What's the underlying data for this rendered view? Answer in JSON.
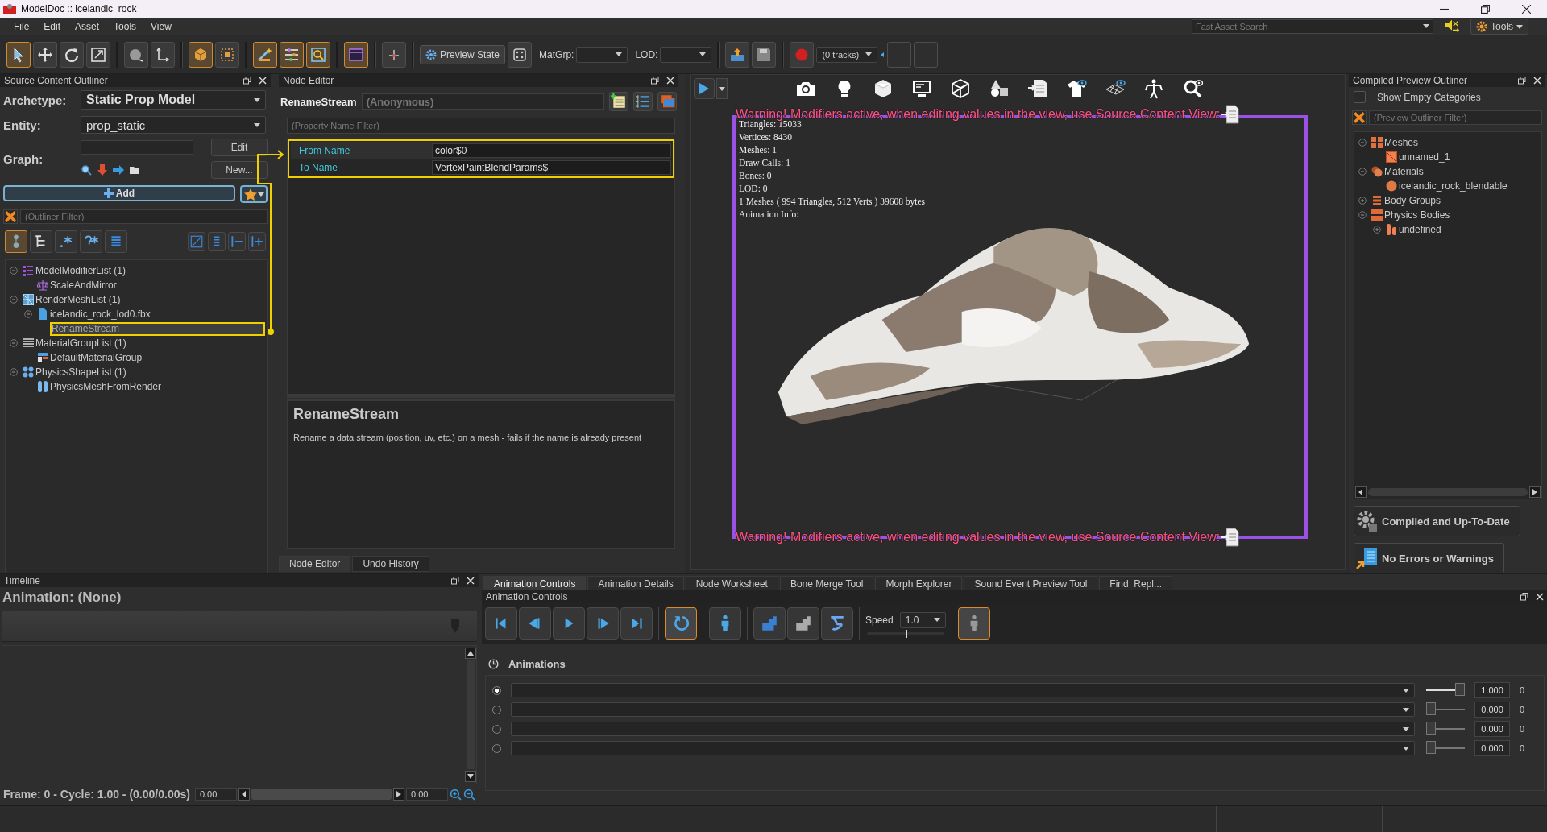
{
  "window": {
    "title": "ModelDoc :: icelandic_rock"
  },
  "menu": [
    "File",
    "Edit",
    "Asset",
    "Tools",
    "View"
  ],
  "search": {
    "placeholder": "Fast Asset Search"
  },
  "tools_button": "Tools",
  "toolbar": {
    "tools": [
      {
        "kind": "select",
        "selected": true
      },
      {
        "kind": "move",
        "selected": false
      },
      {
        "kind": "rotate",
        "selected": false
      },
      {
        "kind": "scale",
        "selected": false
      },
      {
        "kind": "sphere",
        "selected": false
      },
      {
        "kind": "axis",
        "selected": false
      },
      {
        "kind": "box",
        "selected": true
      },
      {
        "kind": "bounds",
        "selected": false
      },
      {
        "kind": "wand",
        "selected": true
      },
      {
        "kind": "layers",
        "selected": true
      },
      {
        "kind": "capture",
        "selected": true
      },
      {
        "kind": "frame",
        "selected": true
      },
      {
        "kind": "origin",
        "selected": false
      }
    ],
    "preview_state": "Preview State",
    "matgrp_label": "MatGrp:",
    "lod_label": "LOD:",
    "tracks": "(0 tracks)"
  },
  "source_outliner": {
    "title": "Source Content Outliner",
    "archetype_label": "Archetype:",
    "archetype": "Static Prop Model",
    "entity_label": "Entity:",
    "entity": "prop_static",
    "graph_label": "Graph:",
    "edit_button": "Edit",
    "new_button": "New...",
    "add_button": "Add",
    "filter": {
      "placeholder": "(Outliner Filter)"
    },
    "tree": [
      {
        "label": "ModelModifierList (1)",
        "kind": "modifier-list",
        "expanded": true,
        "selected": false,
        "children": [
          {
            "label": "ScaleAndMirror",
            "kind": "modifier",
            "selected": false
          }
        ]
      },
      {
        "label": "RenderMeshList (1)",
        "kind": "mesh-list",
        "expanded": true,
        "selected": false,
        "children": [
          {
            "label": "icelandic_rock_lod0.fbx",
            "kind": "file",
            "expanded": true,
            "selected": false,
            "children": [
              {
                "label": "RenameStream",
                "selected": true
              }
            ]
          }
        ]
      },
      {
        "label": "MaterialGroupList (1)",
        "kind": "material-list",
        "expanded": true,
        "selected": false,
        "children": [
          {
            "label": "DefaultMaterialGroup",
            "kind": "material-group",
            "selected": false
          }
        ]
      },
      {
        "label": "PhysicsShapeList (1)",
        "kind": "physics-list",
        "expanded": true,
        "selected": false,
        "children": [
          {
            "label": "PhysicsMeshFromRender",
            "kind": "physics-shape",
            "selected": false
          }
        ]
      }
    ]
  },
  "node_editor": {
    "title": "Node Editor",
    "node_name": "RenameStream",
    "node_label": "(Anonymous)",
    "filter": {
      "placeholder": "(Property Name Filter)"
    },
    "properties": [
      {
        "name": "From Name",
        "value": "color$0"
      },
      {
        "name": "To Name",
        "value": "VertexPaintBlendParams$"
      }
    ],
    "help_title": "RenameStream",
    "help_text": "Rename a data stream (position, uv, etc.) on a mesh - fails if the name is already present",
    "tabs": [
      {
        "label": "Node Editor",
        "selected": true
      },
      {
        "label": "Undo History",
        "selected": false
      }
    ]
  },
  "viewport": {
    "warning_top": "Warning! Modifiers active, when editing values in the view, use Source Content View:",
    "warning_bottom": "Warning! Modifiers active, when editing values in the view, use Source Content View:",
    "stats": [
      "Triangles: 15033",
      "Vertices: 8430",
      "Meshes: 1",
      "Draw Calls: 1",
      "Bones: 0",
      "LOD: 0",
      "1 Meshes ( 994 Triangles, 512 Verts ) 39608 bytes",
      "Animation Info:"
    ]
  },
  "preview_outliner": {
    "title": "Compiled Preview Outliner",
    "show_empty": {
      "label": "Show Empty Categories",
      "checked": false
    },
    "filter": {
      "placeholder": "(Preview Outliner Filter)"
    },
    "tree": [
      {
        "label": "Meshes",
        "kind": "meshes",
        "expanded": true,
        "selected": false,
        "children": [
          {
            "label": "unnamed_1",
            "kind": "mesh",
            "selected": false
          }
        ]
      },
      {
        "label": "Materials",
        "kind": "materials",
        "expanded": true,
        "selected": false,
        "children": [
          {
            "label": "icelandic_rock_blendable",
            "kind": "material",
            "selected": false
          }
        ]
      },
      {
        "label": "Body Groups",
        "kind": "body-groups",
        "expanded": false,
        "selected": false
      },
      {
        "label": "Physics Bodies",
        "kind": "physics-bodies",
        "expanded": true,
        "selected": false,
        "children": [
          {
            "label": "undefined",
            "kind": "physics-body",
            "expanded": false,
            "selected": false
          }
        ]
      }
    ]
  },
  "status_buttons": [
    {
      "kind": "compiled",
      "label": "Compiled and Up-To-Date"
    },
    {
      "kind": "errors",
      "label": "No Errors or Warnings"
    }
  ],
  "timeline": {
    "title": "Timeline",
    "animation": "Animation: (None)",
    "footer": "Frame: **0** - Cycle: **1.00** - (0.00/0.00s)",
    "start": "0.00",
    "end": "0.00"
  },
  "bottom_tabs": [
    {
      "label": "Animation Controls",
      "selected": true
    },
    {
      "label": "Animation Details",
      "selected": false
    },
    {
      "label": "Node Worksheet",
      "selected": false
    },
    {
      "label": "Bone Merge Tool",
      "selected": false
    },
    {
      "label": "Morph Explorer",
      "selected": false
    },
    {
      "label": "Sound Event Preview Tool",
      "selected": false
    },
    {
      "label": "Find  Repl...",
      "selected": false
    }
  ],
  "animation_controls": {
    "title": "Animation Controls",
    "buttons": [
      {
        "kind": "first",
        "selected": false
      },
      {
        "kind": "prev",
        "selected": false
      },
      {
        "kind": "play",
        "selected": false
      },
      {
        "kind": "next",
        "selected": false
      },
      {
        "kind": "last",
        "selected": false
      },
      {
        "kind": "loop",
        "selected": true
      },
      {
        "kind": "figure",
        "selected": false
      },
      {
        "kind": "blocks",
        "selected": false
      },
      {
        "kind": "grey-blocks",
        "selected": false
      },
      {
        "kind": "cloth",
        "selected": false
      }
    ],
    "speed_label": "Speed",
    "speed": {
      "value": "1.0",
      "level": 0.5
    },
    "ghost_selected": true,
    "animations_label": "Animations",
    "rows": [
      {
        "selected": true,
        "level": 1,
        "reading": "1.000",
        "count": "0"
      },
      {
        "selected": false,
        "level": 0,
        "reading": "0.000",
        "count": "0"
      },
      {
        "selected": false,
        "level": 0,
        "reading": "0.000",
        "count": "0"
      },
      {
        "selected": false,
        "level": 0,
        "reading": "0.000",
        "count": "0"
      }
    ]
  }
}
